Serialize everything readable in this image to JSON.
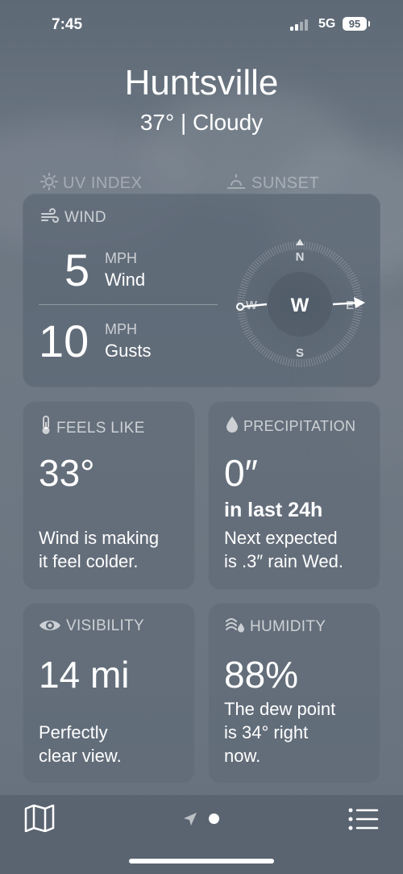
{
  "status_bar": {
    "time": "7:45",
    "network": "5G",
    "battery": "95"
  },
  "location": {
    "city": "Huntsville",
    "summary": "37°  |  Cloudy"
  },
  "background_cards": {
    "uv_title": "UV INDEX",
    "sunset_title": "SUNSET"
  },
  "wind": {
    "title": "WIND",
    "speed": "5",
    "speed_unit": "MPH",
    "speed_label": "Wind",
    "gusts": "10",
    "gusts_unit": "MPH",
    "gusts_label": "Gusts",
    "compass": {
      "north": "N",
      "south": "S",
      "west": "W",
      "east": "E",
      "direction": "W"
    }
  },
  "feels_like": {
    "title": "FEELS LIKE",
    "value": "33°",
    "line1": "Wind is making",
    "line2": "it feel colder."
  },
  "precipitation": {
    "title": "PRECIPITATION",
    "value": "0″",
    "period": "in last 24h",
    "line1": "Next expected",
    "line2": "is .3″ rain Wed."
  },
  "visibility": {
    "title": "VISIBILITY",
    "value": "14 mi",
    "line1": "Perfectly",
    "line2": "clear view."
  },
  "humidity": {
    "title": "HUMIDITY",
    "value": "88%",
    "line1": "The dew point",
    "line2": "is 34° right",
    "line3": "now."
  },
  "colors": {
    "card": "#5c6774",
    "text": "#ffffff",
    "muted": "#c3c9d0"
  },
  "icons": [
    "sun-icon",
    "sunset-icon",
    "wind-icon",
    "thermometer-icon",
    "droplet-icon",
    "eye-icon",
    "humidity-icon",
    "map-icon",
    "location-arrow-icon",
    "list-icon"
  ]
}
